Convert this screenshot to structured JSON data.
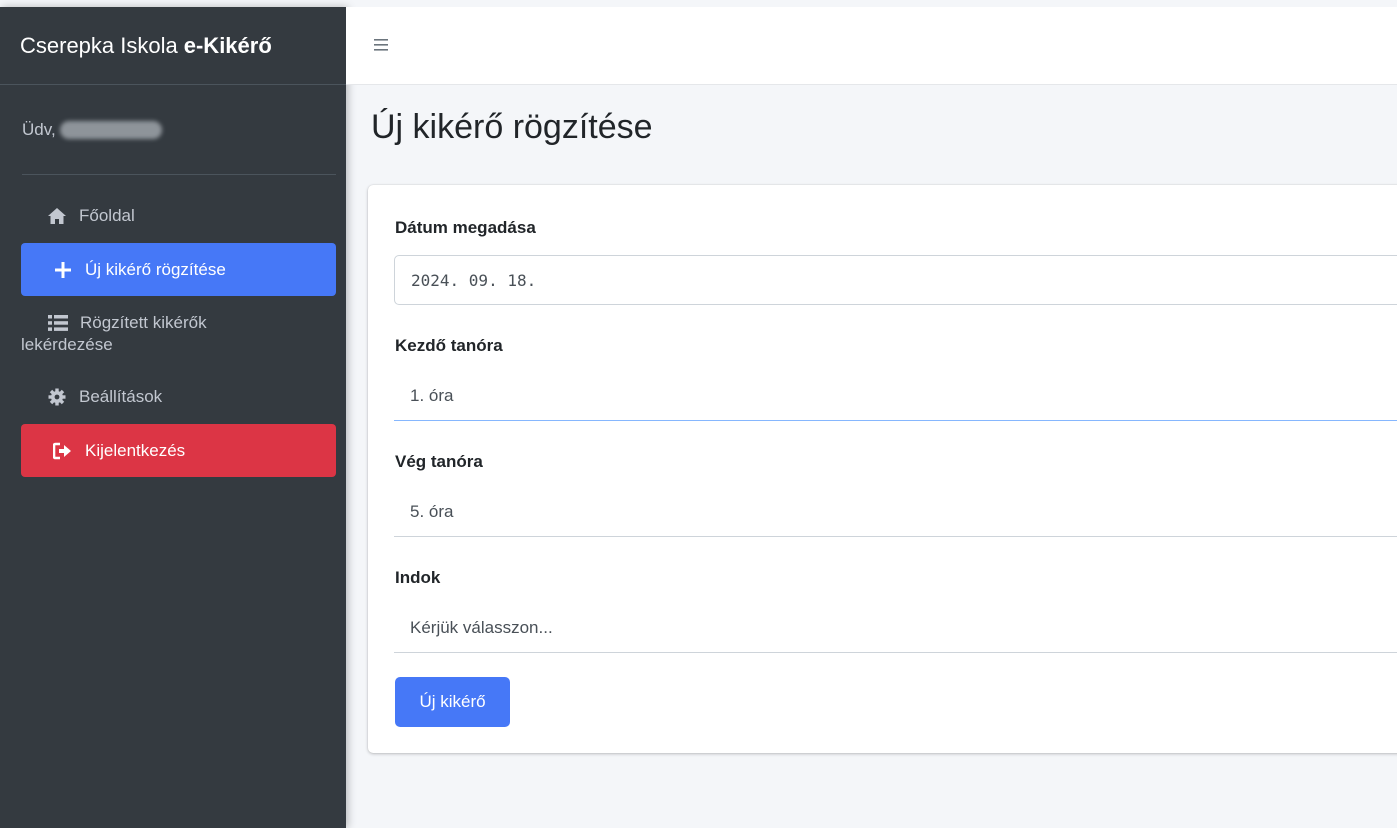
{
  "brand": {
    "school": "Cserepka Iskola",
    "app": "e-Kikérő"
  },
  "user": {
    "greeting": "Üdv,"
  },
  "sidebar": {
    "items": [
      {
        "label": "Főoldal",
        "icon": "home-icon"
      },
      {
        "label": "Új kikérő rögzítése",
        "icon": "plus-icon",
        "active": true
      },
      {
        "label_line1": "Rögzített kikérők",
        "label_line2": "lekérdezése",
        "icon": "list-icon"
      },
      {
        "label": "Beállítások",
        "icon": "gear-icon"
      },
      {
        "label": "Kijelentkezés",
        "icon": "sign-out-icon",
        "danger": true
      }
    ]
  },
  "topbar": {
    "menu_icon": "hamburger-icon"
  },
  "main": {
    "title": "Új kikérő rögzítése",
    "form": {
      "date_label": "Dátum megadása",
      "date_value": "2024. 09. 18.",
      "start_label": "Kezdő tanóra",
      "start_value": "1. óra",
      "end_label": "Vég tanóra",
      "end_value": "5. óra",
      "reason_label": "Indok",
      "reason_placeholder": "Kérjük válasszon...",
      "submit_label": "Új kikérő"
    }
  },
  "colors": {
    "sidebar_bg": "#343a40",
    "primary": "#4678f7",
    "danger": "#dc3545",
    "page_bg": "#f4f6f9"
  }
}
